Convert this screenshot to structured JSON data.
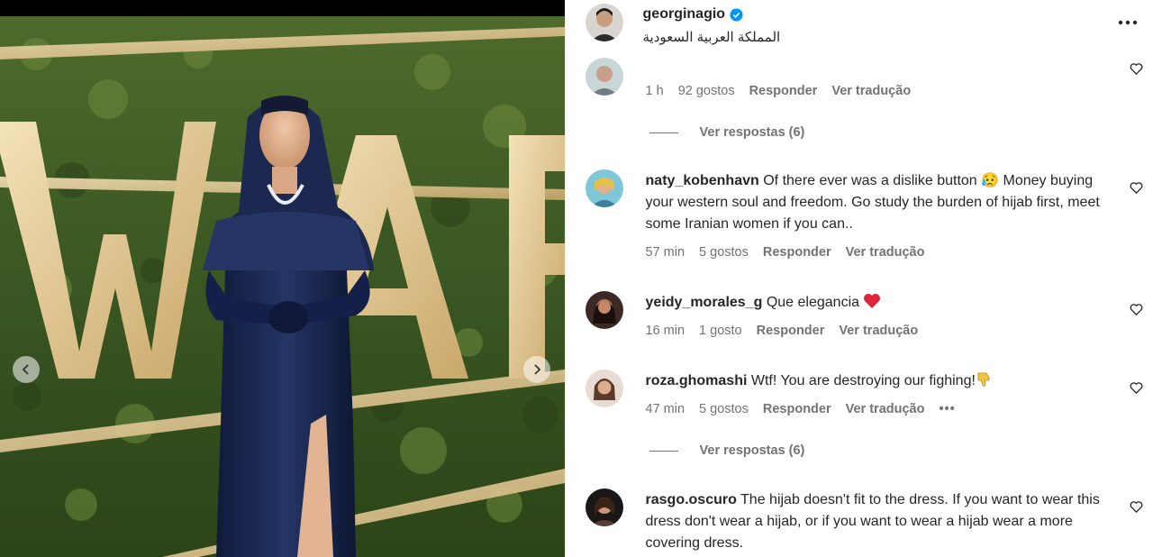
{
  "post": {
    "username": "georginagio",
    "location": "المملكة العربية السعودية",
    "verified_icon": "verified-badge-icon",
    "more_icon": "more-options-icon"
  },
  "photo": {
    "sign_text": "WAF",
    "prev_icon": "chevron-left-icon",
    "next_icon": "chevron-right-icon"
  },
  "comments": [
    {
      "username": "",
      "text": "ـ ـ ـ ـ ـ ـ ـ ـ ـ ـ ـ ـ ـ ـ",
      "time": "1 h",
      "likes": "92 gostos",
      "reply": "Responder",
      "translate": "Ver tradução",
      "view_replies": "Ver respostas (6)"
    },
    {
      "username": "naty_kobenhavn",
      "text": "Of there ever was a dislike button 😥 Money buying your western soul and freedom. Go study the burden of hijab first, meet some Iranian women if you can..",
      "time": "57 min",
      "likes": "5 gostos",
      "reply": "Responder",
      "translate": "Ver tradução"
    },
    {
      "username": "yeidy_morales_g",
      "text": "Que elegancia",
      "time": "16 min",
      "likes": "1 gosto",
      "reply": "Responder",
      "translate": "Ver tradução"
    },
    {
      "username": "roza.ghomashi",
      "text": "Wtf! You are destroying our fighing!",
      "time": "47 min",
      "likes": "5 gostos",
      "reply": "Responder",
      "translate": "Ver tradução",
      "more": "•••",
      "view_replies": "Ver respostas (6)"
    },
    {
      "username": "rasgo.oscuro",
      "text": "The hijab doesn't fit to the dress. If you want to wear this dress don't wear a hijab, or if you want to wear a hijab wear a more covering dress."
    }
  ],
  "colors": {
    "text": "#262626",
    "secondary": "#737373",
    "verified_blue": "#0095f6",
    "heart_red": "#ed4956"
  }
}
